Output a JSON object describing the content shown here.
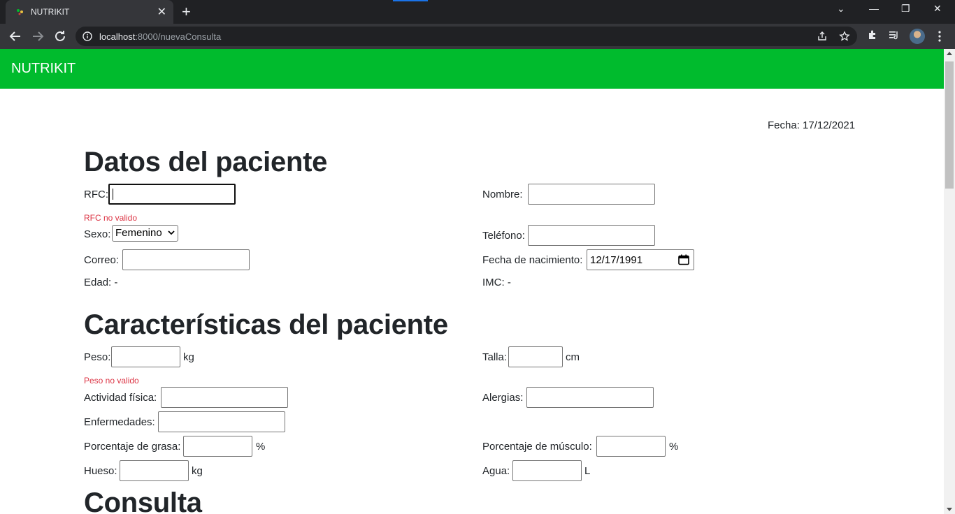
{
  "browser": {
    "tab_title": "NUTRIKIT",
    "tab_close": "✕",
    "new_tab": "+",
    "url_host": "localhost",
    "url_rest": ":8000/nuevaConsulta",
    "controls": {
      "dropdown": "⌄",
      "minimize": "—",
      "restore": "❐",
      "close": "✕"
    }
  },
  "navbar": {
    "brand": "NUTRIKIT"
  },
  "fecha": "Fecha: 17/12/2021",
  "sections": {
    "datos": "Datos del paciente",
    "caracteristicas": "Características del paciente",
    "consulta": "Consulta"
  },
  "datos": {
    "rfc_label": "RFC:",
    "rfc_value": "",
    "rfc_error": "RFC no valido",
    "nombre_label": "Nombre:",
    "sexo_label": "Sexo:",
    "sexo_value": "Femenino",
    "telefono_label": "Teléfono:",
    "correo_label": "Correo:",
    "fecha_nac_label": "Fecha de nacimiento:",
    "fecha_nac_value": "12/17/1991",
    "edad_text": "Edad: -",
    "imc_text": "IMC: -"
  },
  "caracteristicas": {
    "peso_label": "Peso:",
    "peso_unit": "kg",
    "peso_error": "Peso no valido",
    "talla_label": "Talla:",
    "talla_unit": "cm",
    "actividad_label": "Actividad física:",
    "alergias_label": "Alergias:",
    "enfermedades_label": "Enfermedades:",
    "grasa_label": "Porcentaje de grasa:",
    "grasa_unit": "%",
    "musculo_label": "Porcentaje de músculo:",
    "musculo_unit": "%",
    "hueso_label": "Hueso:",
    "hueso_unit": "kg",
    "agua_label": "Agua:",
    "agua_unit": "L"
  }
}
